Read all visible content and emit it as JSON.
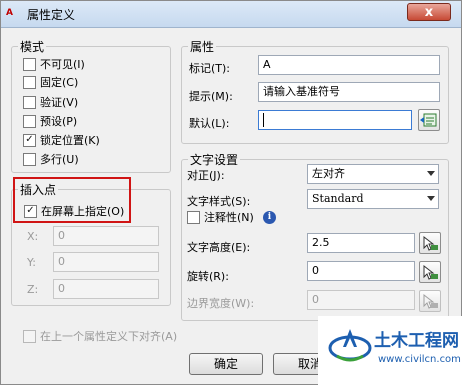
{
  "window": {
    "title": "属性定义",
    "app_icon_text": "A",
    "close_symbol": "x"
  },
  "mode": {
    "legend": "模式",
    "items": [
      {
        "label": "不可见(I)",
        "checked": false
      },
      {
        "label": "固定(C)",
        "checked": false
      },
      {
        "label": "验证(V)",
        "checked": false
      },
      {
        "label": "预设(P)",
        "checked": false
      },
      {
        "label": "锁定位置(K)",
        "checked": true
      },
      {
        "label": "多行(U)",
        "checked": false
      }
    ]
  },
  "insert": {
    "legend": "插入点",
    "on_screen_label": "在屏幕上指定(O)",
    "on_screen_checked": true,
    "x_label": "X:",
    "x_value": "0",
    "y_label": "Y:",
    "y_value": "0",
    "z_label": "Z:",
    "z_value": "0"
  },
  "attribute": {
    "legend": "属性",
    "tag_label": "标记(T):",
    "tag_value": "A",
    "prompt_label": "提示(M):",
    "prompt_value": "请输入基准符号",
    "default_label": "默认(L):",
    "default_value": ""
  },
  "text": {
    "legend": "文字设置",
    "justify_label": "对正(J):",
    "justify_value": "左对齐",
    "style_label": "文字样式(S):",
    "style_value": "Standard",
    "annotative_label": "注释性(N)",
    "annotative_checked": false,
    "info_symbol": "i",
    "height_label": "文字高度(E):",
    "height_value": "2.5",
    "rotation_label": "旋转(R):",
    "rotation_value": "0",
    "boundary_label": "边界宽度(W):",
    "boundary_value": "0"
  },
  "align_below_label": "在上一个属性定义下对齐(A)",
  "ok_label": "确定",
  "cancel_label": "取消",
  "watermark": {
    "title": "土木工程网",
    "url": "www.civilcn.com"
  },
  "colors": {
    "highlight_box": "#d01414",
    "watermark_blue": "#1d5fb0"
  }
}
